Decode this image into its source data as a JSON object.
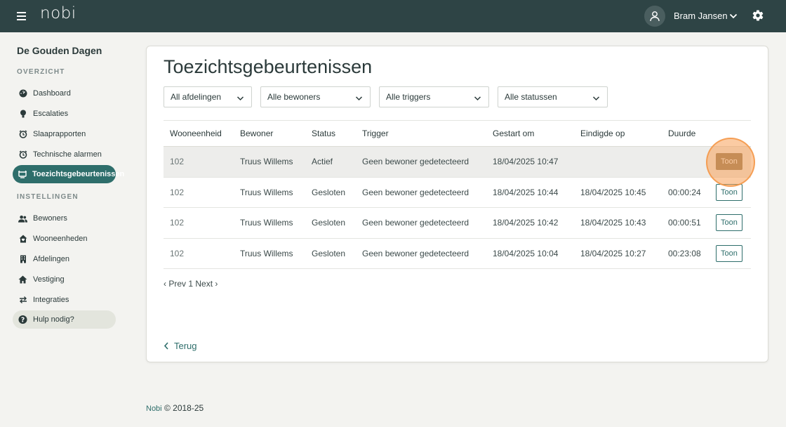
{
  "header": {
    "logo": "nobi",
    "user_name": "Bram Jansen"
  },
  "sidebar": {
    "org_name": "De Gouden Dagen",
    "section_overview": "OVERZICHT",
    "section_settings": "INSTELLINGEN",
    "overview_items": [
      {
        "label": "Dashboard",
        "icon": "dashboard-icon"
      },
      {
        "label": "Escalaties",
        "icon": "lightbulb-icon"
      },
      {
        "label": "Slaaprapporten",
        "icon": "alarm-clock-icon"
      },
      {
        "label": "Technische alarmen",
        "icon": "alarm-clock-icon"
      },
      {
        "label": "Toezichtsgebeurtenissen",
        "icon": "monitor-icon"
      }
    ],
    "settings_items": [
      {
        "label": "Bewoners",
        "icon": "people-icon"
      },
      {
        "label": "Wooneenheden",
        "icon": "home-heart-icon"
      },
      {
        "label": "Afdelingen",
        "icon": "building-icon"
      },
      {
        "label": "Vestiging",
        "icon": "house-icon"
      },
      {
        "label": "Integraties",
        "icon": "swap-arrows-icon"
      }
    ],
    "help": "Hulp nodig?"
  },
  "main": {
    "title": "Toezichtsgebeurtenissen",
    "filters": {
      "department": "All afdelingen",
      "residents": "Alle bewoners",
      "triggers": "Alle triggers",
      "statuses": "Alle statussen"
    },
    "table": {
      "columns": [
        "Wooneenheid",
        "Bewoner",
        "Status",
        "Trigger",
        "Gestart om",
        "Eindigde op",
        "Duurde"
      ],
      "rows": [
        {
          "unit": "102",
          "resident": "Truus Willems",
          "status": "Actief",
          "trigger": "Geen bewoner gedetecteerd",
          "started": "18/04/2025 10:47",
          "ended": "",
          "duration": "",
          "action": "Toon"
        },
        {
          "unit": "102",
          "resident": "Truus Willems",
          "status": "Gesloten",
          "trigger": "Geen bewoner gedetecteerd",
          "started": "18/04/2025 10:44",
          "ended": "18/04/2025 10:45",
          "duration": "00:00:24",
          "action": "Toon"
        },
        {
          "unit": "102",
          "resident": "Truus Willems",
          "status": "Gesloten",
          "trigger": "Geen bewoner gedetecteerd",
          "started": "18/04/2025 10:42",
          "ended": "18/04/2025 10:43",
          "duration": "00:00:51",
          "action": "Toon"
        },
        {
          "unit": "102",
          "resident": "Truus Willems",
          "status": "Gesloten",
          "trigger": "Geen bewoner gedetecteerd",
          "started": "18/04/2025 10:04",
          "ended": "18/04/2025 10:27",
          "duration": "00:23:08",
          "action": "Toon"
        }
      ]
    },
    "pager": {
      "prev": "‹ Prev",
      "page": "1",
      "next": "Next ›"
    },
    "back": "Terug"
  },
  "footer": {
    "brand": "Nobi",
    "copyright": "© 2018-25"
  },
  "colors": {
    "topbar": "#2e4445",
    "accent": "#2e6e6b",
    "hover_button": "#8a7654",
    "cursor_halo": "#f7a058"
  }
}
